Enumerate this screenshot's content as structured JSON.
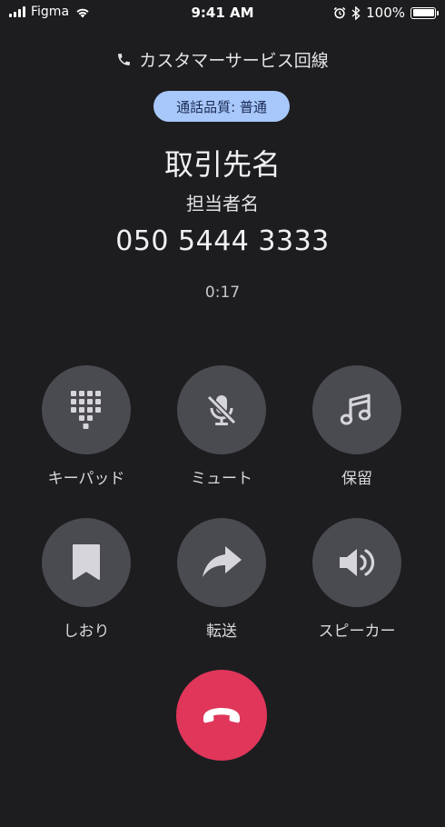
{
  "status_bar": {
    "carrier": "Figma",
    "time": "9:41 AM",
    "battery": "100%"
  },
  "call": {
    "line_name": "カスタマーサービス回線",
    "quality_badge": "通話品質: 普通",
    "contact_name": "取引先名",
    "person_name": "担当者名",
    "phone_number": "050 5444 3333",
    "duration": "0:17"
  },
  "controls": {
    "keypad": "キーパッド",
    "mute": "ミュート",
    "hold": "保留",
    "bookmark": "しおり",
    "transfer": "転送",
    "speaker": "スピーカー"
  },
  "icons": {
    "keypad": "keypad-icon",
    "mute": "mic-off-icon",
    "hold": "music-note-icon",
    "bookmark": "bookmark-icon",
    "transfer": "forward-arrow-icon",
    "speaker": "speaker-icon",
    "end_call": "hang-up-icon"
  },
  "colors": {
    "background": "#1d1d20",
    "button": "#4a4b50",
    "badge": "#a8c7fa",
    "end_call": "#e0365a"
  }
}
